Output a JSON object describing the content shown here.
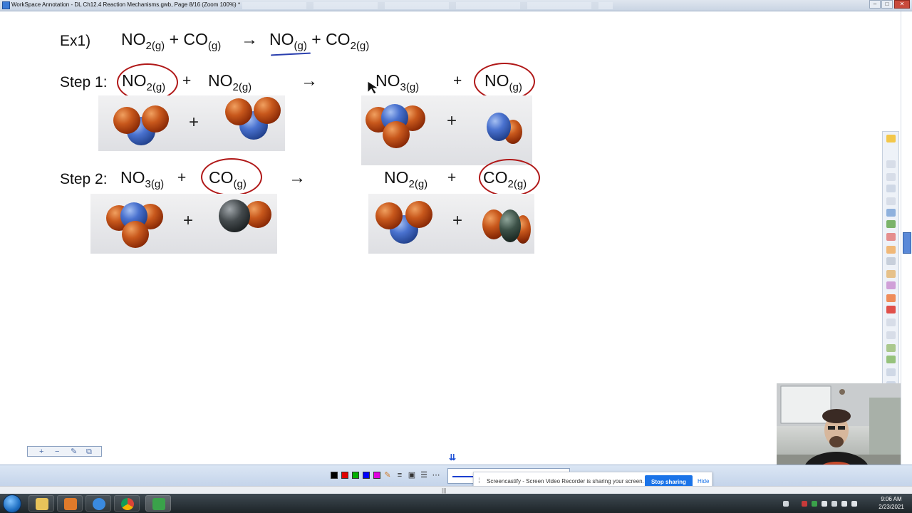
{
  "window": {
    "title": "WorkSpace Annotation - DL Ch12.4 Reaction Mechanisms.gwb, Page 8/16  (Zoom 100%) *",
    "controls": {
      "minimize": "–",
      "maximize": "□",
      "close": "✕"
    }
  },
  "slide": {
    "ex1": {
      "label": "Ex1)",
      "equation": {
        "r1": "NO",
        "r1_sub": "2(g)",
        "plus1": "+",
        "r2": "CO",
        "r2_sub": "(g)",
        "arrow": "→",
        "p1": "NO",
        "p1_sub": "(g)",
        "plus2": "+",
        "p2": "CO",
        "p2_sub": "2(g)"
      }
    },
    "step1": {
      "label": "Step 1:",
      "r1": "NO",
      "r1_sub": "2(g)",
      "plus1": "+",
      "r2": "NO",
      "r2_sub": "2(g)",
      "arrow": "→",
      "p1": "NO",
      "p1_sub": "3(g)",
      "plus2": "+",
      "p2": "NO",
      "p2_sub": "(g)",
      "model_plus": "+"
    },
    "step2": {
      "label": "Step 2:",
      "r1": "NO",
      "r1_sub": "3(g)",
      "plus1": "+",
      "r2": "CO",
      "r2_sub": "(g)",
      "arrow": "→",
      "p1": "NO",
      "p1_sub": "2(g)",
      "plus2": "+",
      "p2": "CO",
      "p2_sub": "2(g)",
      "model_plus": "+"
    },
    "annotation_color": "#b01818",
    "underline_color": "#2a3fae"
  },
  "zoom_controls": {
    "zoom_in": "+",
    "zoom_out": "−",
    "edit": "✎",
    "fit": "⧉"
  },
  "annotation_toolbar": {
    "colors": [
      "#000000",
      "#e00000",
      "#00b000",
      "#0000ff",
      "#e000e0"
    ],
    "pen_color": "#1b3fd0",
    "expand": "⇊"
  },
  "screencastify": {
    "message": "Screencastify - Screen Video Recorder is sharing your screen.",
    "stop_label": "Stop sharing",
    "hide_label": "Hide"
  },
  "taskbar": {
    "time": "9:06 AM",
    "date": "2/23/2021"
  }
}
